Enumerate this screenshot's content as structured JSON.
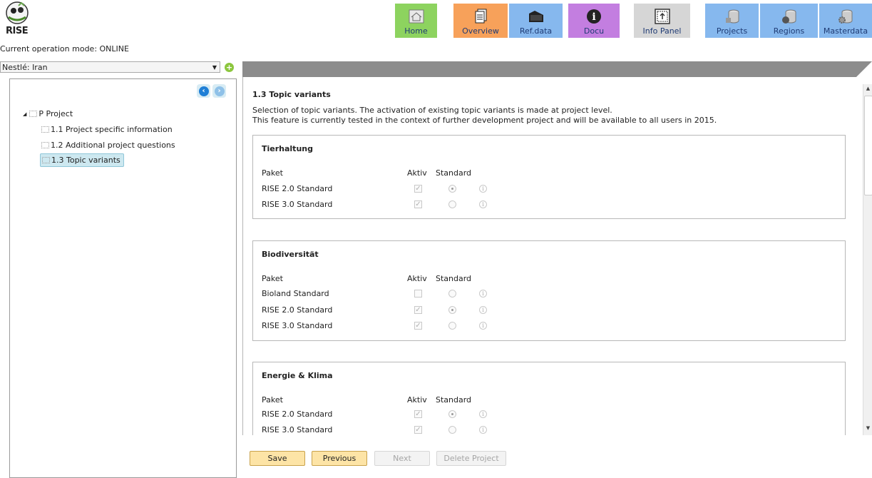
{
  "app": {
    "logo_text": "RISE",
    "mode_text": "Current operation mode: ONLINE"
  },
  "nav": [
    {
      "label": "Home",
      "icon": "home-icon",
      "color": "#8dd35f"
    },
    {
      "label": "Overview",
      "icon": "documents-icon",
      "color": "#f7a15a"
    },
    {
      "label": "Ref.data",
      "icon": "folder-icon",
      "color": "#86b8ee"
    },
    {
      "label": "Docu",
      "icon": "info-icon",
      "color": "#c37ee0"
    },
    {
      "label": "Info Panel",
      "icon": "info-panel-icon",
      "color": "#d6d6d6"
    },
    {
      "label": "Projects",
      "icon": "database-icon",
      "color": "#86b8ee"
    },
    {
      "label": "Regions",
      "icon": "database-globe-icon",
      "color": "#86b8ee"
    },
    {
      "label": "Masterdata",
      "icon": "database-gear-icon",
      "color": "#86b8ee"
    }
  ],
  "sidebar": {
    "project_select": "Nestlé: Iran",
    "tree": {
      "root": "P Project",
      "items": [
        {
          "label": "1.1 Project specific information"
        },
        {
          "label": "1.2 Additional project questions"
        },
        {
          "label": "1.3 Topic variants"
        }
      ]
    }
  },
  "main": {
    "section_title": "1.3 Topic variants",
    "description_line1": "Selection of topic variants. The activation of existing topic variants is made at project level.",
    "description_line2": "This feature is currently tested in the context of further development project and will be available to all users in 2015.",
    "col_paket": "Paket",
    "col_aktiv": "Aktiv",
    "col_standard": "Standard",
    "groups": [
      {
        "title": "Tierhaltung",
        "rows": [
          {
            "paket": "RISE 2.0 Standard",
            "aktiv": true,
            "standard": true
          },
          {
            "paket": "RISE 3.0 Standard",
            "aktiv": true,
            "standard": false
          }
        ]
      },
      {
        "title": "Biodiversität",
        "rows": [
          {
            "paket": "Bioland Standard",
            "aktiv": false,
            "standard": false
          },
          {
            "paket": "RISE 2.0 Standard",
            "aktiv": true,
            "standard": true
          },
          {
            "paket": "RISE 3.0 Standard",
            "aktiv": true,
            "standard": false
          }
        ]
      },
      {
        "title": "Energie & Klima",
        "rows": [
          {
            "paket": "RISE 2.0 Standard",
            "aktiv": true,
            "standard": true
          },
          {
            "paket": "RISE 3.0 Standard",
            "aktiv": true,
            "standard": false
          }
        ]
      }
    ]
  },
  "buttons": {
    "save": "Save",
    "previous": "Previous",
    "next": "Next",
    "delete": "Delete Project"
  }
}
